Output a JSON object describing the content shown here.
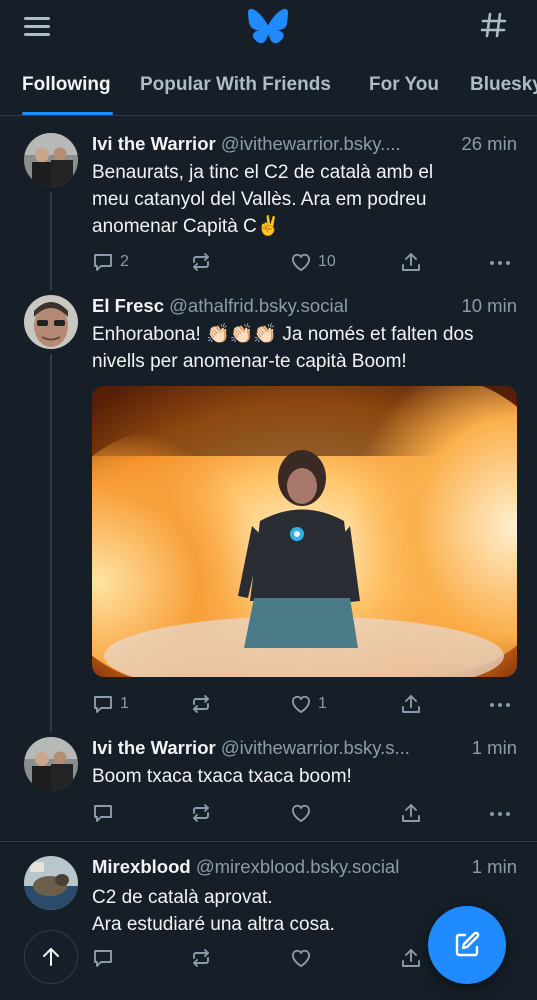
{
  "header": {
    "menu_icon": "hamburger-menu-icon",
    "logo_icon": "bluesky-butterfly-icon",
    "feeds_icon": "hashtag-icon",
    "accent_color": "#208bfe"
  },
  "tabs": [
    {
      "label": "Following",
      "active": true
    },
    {
      "label": "Popular With Friends",
      "active": false
    },
    {
      "label": "For You",
      "active": false
    },
    {
      "label": "Bluesky",
      "active": false
    }
  ],
  "posts": [
    {
      "name": "Ivi the Warrior",
      "handle": "@ivithewarrior.bsky....",
      "time": "26 min",
      "text_lines": [
        "Benaurats, ja tinc el C2 de català amb el",
        "meu catanyol del Vallès. Ara em podreu",
        "anomenar Capità C✌️"
      ],
      "replies": "2",
      "reposts": "",
      "likes": "10"
    },
    {
      "name": "El Fresc",
      "handle": "@athalfrid.bsky.social",
      "time": "10 min",
      "text_lines": [
        "Enhorabona! 👏🏻👏🏻👏🏻 Ja només et falten dos",
        "nivells per anomenar-te capità Boom!"
      ],
      "replies": "1",
      "reposts": "",
      "likes": "1"
    },
    {
      "name": "Ivi the Warrior",
      "handle": "@ivithewarrior.bsky.s...",
      "time": "1 min",
      "text_lines": [
        "Boom txaca txaca txaca boom!"
      ],
      "replies": "",
      "reposts": "",
      "likes": ""
    },
    {
      "name": "Mirexblood",
      "handle": "@mirexblood.bsky.social",
      "time": "1 min",
      "text_lines": [
        "C2 de català aprovat.",
        "Ara estudiaré una altra cosa."
      ],
      "replies": "",
      "reposts": "",
      "likes": ""
    }
  ],
  "action_icons": {
    "reply": "reply-bubble-icon",
    "repost": "repost-arrows-icon",
    "like": "heart-icon",
    "share": "share-upload-icon",
    "more": "more-dots-icon"
  },
  "fab": {
    "compose_icon": "compose-pencil-icon",
    "scroll_top_icon": "arrow-up-icon"
  }
}
